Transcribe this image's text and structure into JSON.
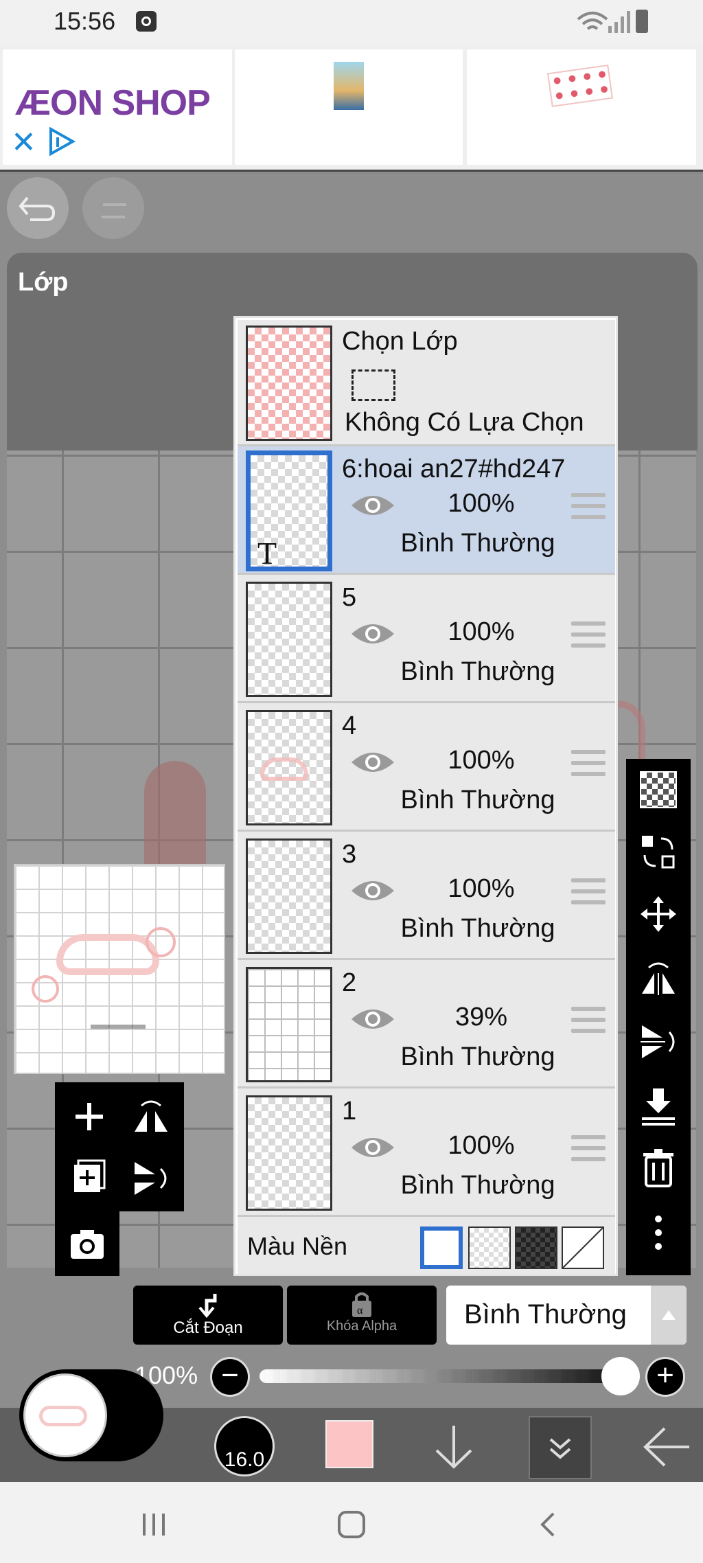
{
  "status_bar": {
    "time": "15:56"
  },
  "ad": {
    "brand": "ÆON SHOP"
  },
  "layers_panel": {
    "title": "Lớp",
    "selection": {
      "label": "Chọn Lớp",
      "status": "Không Có Lựa Chọn"
    },
    "layers": [
      {
        "name": "6:hoai an27#hd247",
        "opacity": "100%",
        "blend": "Bình Thường",
        "selected": true
      },
      {
        "name": "5",
        "opacity": "100%",
        "blend": "Bình Thường"
      },
      {
        "name": "4",
        "opacity": "100%",
        "blend": "Bình Thường"
      },
      {
        "name": "3",
        "opacity": "100%",
        "blend": "Bình Thường"
      },
      {
        "name": "2",
        "opacity": "39%",
        "blend": "Bình Thường"
      },
      {
        "name": "1",
        "opacity": "100%",
        "blend": "Bình Thường"
      }
    ],
    "background_label": "Màu Nền",
    "text_layer_glyph": "T"
  },
  "controls": {
    "clip_label": "Cắt Đoạn",
    "alpha_lock_label": "Khóa Alpha",
    "blend_mode": "Bình Thường",
    "opacity": "100%",
    "opacity_value": 1.0
  },
  "toolbar": {
    "brush_size": "16.0",
    "color": "#fcc4c4"
  },
  "colors": {
    "selection_border": "#2f6fce",
    "selected_row": "#cad6ea",
    "panel_header": "#6f6f6f"
  }
}
